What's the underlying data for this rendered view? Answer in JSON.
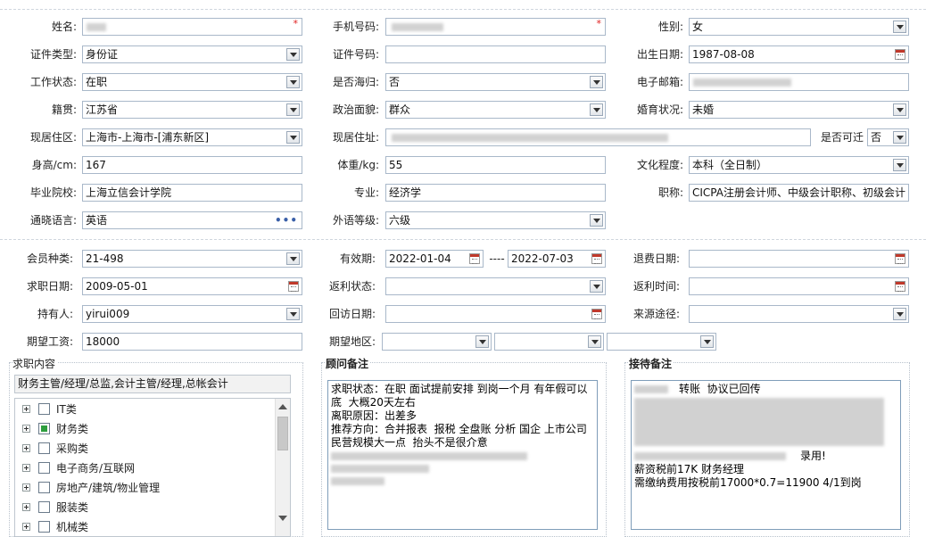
{
  "personal": {
    "name_label": "姓名:",
    "phone_label": "手机号码:",
    "gender_label": "性别:",
    "gender_value": "女",
    "id_type_label": "证件类型:",
    "id_type_value": "身份证",
    "id_no_label": "证件号码:",
    "id_no_value": "",
    "birth_label": "出生日期:",
    "birth_value": "1987-08-08",
    "work_status_label": "工作状态:",
    "work_status_value": "在职",
    "returnee_label": "是否海归:",
    "returnee_value": "否",
    "email_label": "电子邮箱:",
    "native_label": "籍贯:",
    "native_value": "江苏省",
    "political_label": "政治面貌:",
    "political_value": "群众",
    "marital_label": "婚育状况:",
    "marital_value": "未婚",
    "residence_area_label": "现居住区:",
    "residence_area_value": "上海市-上海市-[浦东新区]",
    "address_label": "现居住址:",
    "relocate_label": "是否可迁",
    "relocate_value": "否",
    "height_label": "身高/cm:",
    "height_value": "167",
    "weight_label": "体重/kg:",
    "weight_value": "55",
    "education_label": "文化程度:",
    "education_value": "本科（全日制）",
    "school_label": "毕业院校:",
    "school_value": "上海立信会计学院",
    "major_label": "专业:",
    "major_value": "经济学",
    "title_label": "职称:",
    "title_value": "CICPA注册会计师、中级会计职称、初级会计",
    "language_label": "通晓语言:",
    "language_value": "英语",
    "lang_level_label": "外语等级:",
    "lang_level_value": "六级",
    "required_mark": "*",
    "more_glyph": "•••"
  },
  "membership": {
    "member_type_label": "会员种类:",
    "member_type_value": "21-498",
    "valid_label": "有效期:",
    "valid_from": "2022-01-04",
    "valid_sep": "----",
    "valid_to": "2022-07-03",
    "refund_date_label": "退费日期:",
    "refund_date_value": "",
    "job_date_label": "求职日期:",
    "job_date_value": "2009-05-01",
    "rebate_status_label": "返利状态:",
    "rebate_status_value": "",
    "rebate_time_label": "返利时间:",
    "rebate_time_value": "",
    "holder_label": "持有人:",
    "holder_value": "yirui009",
    "visit_date_label": "回访日期:",
    "visit_date_value": "",
    "source_label": "来源途径:",
    "source_value": "",
    "salary_label": "期望工资:",
    "salary_value": "18000",
    "region_label": "期望地区:"
  },
  "job_content": {
    "title": "求职内容",
    "selected": "财务主管/经理/总监,会计主管/经理,总帐会计",
    "categories": [
      {
        "label": "IT类",
        "checked": false
      },
      {
        "label": "财务类",
        "checked": true
      },
      {
        "label": "采购类",
        "checked": false
      },
      {
        "label": "电子商务/互联网",
        "checked": false
      },
      {
        "label": "房地产/建筑/物业管理",
        "checked": false
      },
      {
        "label": "服装类",
        "checked": false
      },
      {
        "label": "机械类",
        "checked": false
      }
    ]
  },
  "consultant_note": {
    "title": "顾问备注",
    "lines": [
      "求职状态：在职 面试提前安排 到岗一个月 有年假可以底  大概20天左右",
      "离职原因：出差多",
      "推荐方向：合并报表  报税 全盘账 分析 国企 上市公司 民营规模大一点  抬头不是很介意"
    ]
  },
  "reception_note": {
    "title": "接待备注",
    "line1": "转账  协议已回传",
    "line2": "录用!",
    "line3": "薪资税前17K 财务经理",
    "line4": "需缴纳费用按税前17000*0.7=11900 4/1到岗"
  },
  "colors": {
    "field_border": "#a9b8c9",
    "required": "#e02020",
    "checked": "#2e9e3e",
    "divider": "#cfd6de"
  }
}
